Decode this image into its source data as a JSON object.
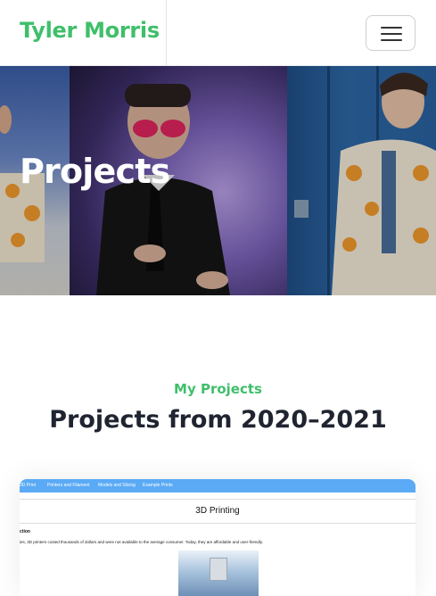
{
  "navbar": {
    "brand": "Tyler Morris",
    "menu_icon": "hamburger-menu-icon"
  },
  "hero": {
    "title": "Projects"
  },
  "projects_section": {
    "subtitle": "My Projects",
    "title": "Projects from 2020–2021"
  },
  "project_card": {
    "preview": {
      "nav_items": [
        "3D Print",
        "Printers and Filament",
        "Models and Slicing",
        "Example Prints"
      ],
      "heading": "3D Printing",
      "section_label": "ction",
      "paragraph": "ies, 3D printers costed thousands of dollars and were not available to the average consumer. Today, they are affordable and user-friendly."
    }
  },
  "colors": {
    "accent": "#3fbf6a",
    "title": "#1f2430",
    "preview_nav": "#5aaaf5"
  }
}
